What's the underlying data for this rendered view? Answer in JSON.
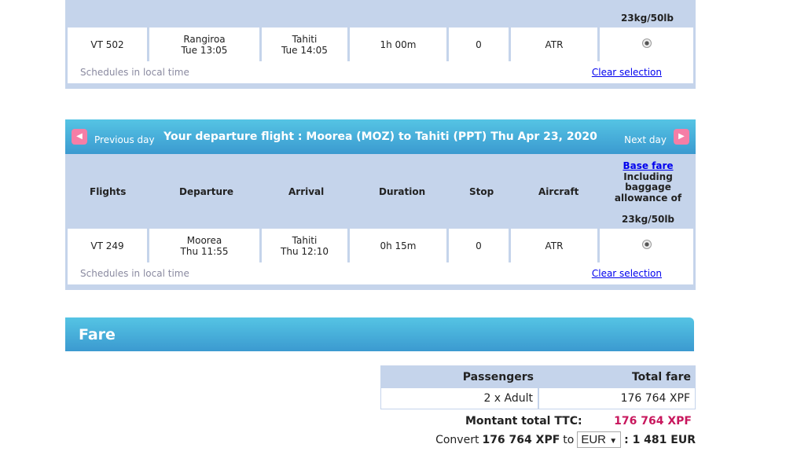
{
  "return_flight": {
    "baggage": "23kg/50lb",
    "row": {
      "flight": "VT 502",
      "dep_city": "Rangiroa",
      "dep_time": "Tue 13:05",
      "arr_city": "Tahiti",
      "arr_time": "Tue 14:05",
      "duration": "1h 00m",
      "stop": "0",
      "aircraft": "ATR"
    },
    "note": "Schedules in local time",
    "clear": "Clear selection"
  },
  "departure_flight": {
    "title": "Your departure flight : Moorea (MOZ) to Tahiti (PPT) Thu Apr 23, 2020",
    "prev": "Previous day",
    "next": "Next day",
    "headers": {
      "flights": "Flights",
      "departure": "Departure",
      "arrival": "Arrival",
      "duration": "Duration",
      "stop": "Stop",
      "aircraft": "Aircraft",
      "base_fare": "Base fare",
      "including": "Including baggage allowance of",
      "baggage": "23kg/50lb"
    },
    "row": {
      "flight": "VT 249",
      "dep_city": "Moorea",
      "dep_time": "Thu 11:55",
      "arr_city": "Tahiti",
      "arr_time": "Thu 12:10",
      "duration": "0h 15m",
      "stop": "0",
      "aircraft": "ATR"
    },
    "note": "Schedules in local time",
    "clear": "Clear selection"
  },
  "fare": {
    "title": "Fare",
    "passengers_header": "Passengers",
    "total_header": "Total fare",
    "passengers": "2 x Adult",
    "total": "176 764 XPF",
    "ttc_label": "Montant total TTC:",
    "ttc_value": "176 764 XPF",
    "convert_label": "Convert",
    "convert_amount": "176 764 XPF",
    "to": "to",
    "currency": "EUR",
    "result": ": 1 481 EUR"
  },
  "colors": {
    "accent": "#c8175d",
    "header_blue": "#3b9ad0",
    "table_bg": "#c5d4eb",
    "nav_pink": "#f57ea6"
  }
}
